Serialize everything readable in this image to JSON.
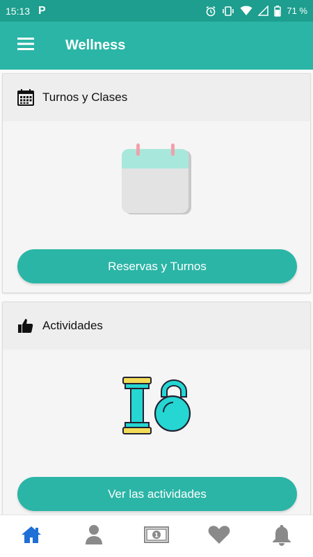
{
  "status_bar": {
    "time": "15:13",
    "app_icon": "P",
    "battery": "71 %"
  },
  "app_bar": {
    "title": "Wellness"
  },
  "cards": [
    {
      "title": "Turnos y Clases",
      "icon": "calendar-icon",
      "button_label": "Reservas y Turnos"
    },
    {
      "title": "Actividades",
      "icon": "thumbs-up-icon",
      "button_label": "Ver las actividades"
    }
  ],
  "bottom_nav": {
    "items": [
      "home-icon",
      "user-icon",
      "money-icon",
      "heart-icon",
      "bell-icon"
    ],
    "active": "home-icon"
  },
  "colors": {
    "primary": "#2bb5a6",
    "status_bar": "#1d9e8e",
    "active_nav": "#1e6fd6",
    "inactive_nav": "#8a8a8a"
  }
}
